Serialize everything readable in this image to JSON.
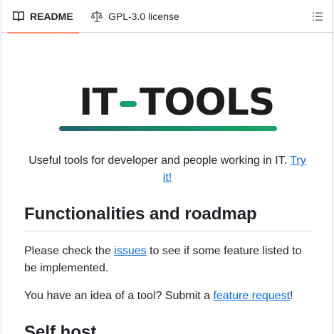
{
  "tabs": {
    "readme": {
      "label": "README",
      "icon": "book-icon"
    },
    "license": {
      "label": "GPL-3.0 license",
      "icon": "law-scale-icon"
    },
    "toc_icon": "list-unordered-icon"
  },
  "logo": {
    "part1": "IT",
    "part2": "TOOLS"
  },
  "intro": {
    "text": "Useful tools for developer and people working in IT. ",
    "link": "Try it!"
  },
  "section1": {
    "heading": "Functionalities and roadmap",
    "p1_before": "Please check the ",
    "p1_link": "issues",
    "p1_after": " to see if some feature listed to be implemented.",
    "p2_before": "You have an idea of a tool? Submit a ",
    "p2_link": "feature request",
    "p2_after": "!"
  },
  "section2": {
    "heading": "Self host"
  },
  "colors": {
    "accent_tab": "#fd8c73",
    "link": "#0969da",
    "logo_green": "#1a9e6e",
    "logo_teal": "#25636c"
  }
}
